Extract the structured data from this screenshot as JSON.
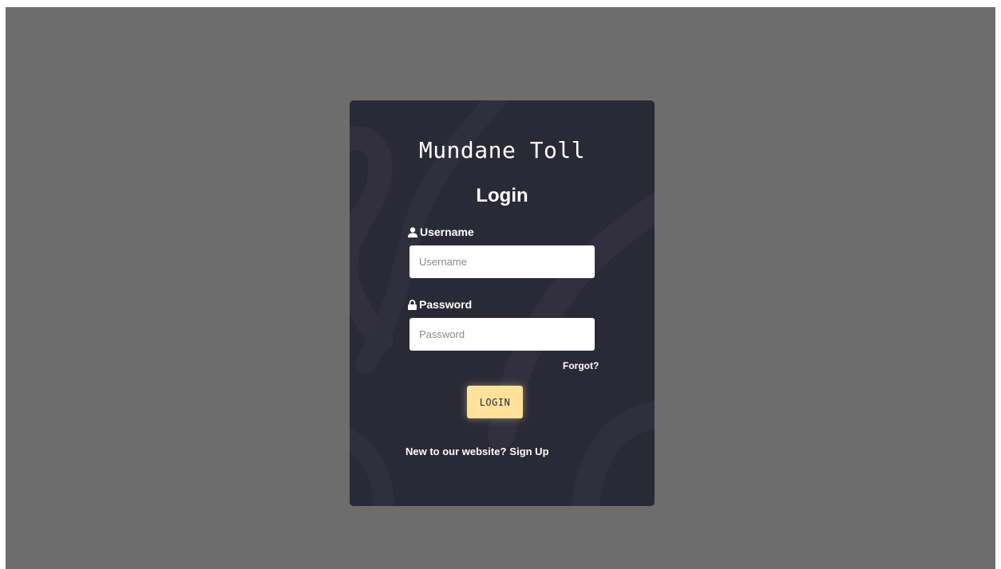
{
  "app": {
    "brand": "Mundane Toll",
    "heading": "Login"
  },
  "form": {
    "username": {
      "label": "Username",
      "placeholder": "Username",
      "value": "",
      "icon": "user-icon"
    },
    "password": {
      "label": "Password",
      "placeholder": "Password",
      "value": "",
      "icon": "lock-icon"
    },
    "forgot_label": "Forgot?",
    "submit_label": "LOGIN"
  },
  "footer": {
    "prompt": "New to our website?",
    "signup_label": "Sign Up"
  },
  "colors": {
    "page_bg": "#6d6d6d",
    "card_bg": "#2a2a36",
    "accent": "#ffe19a",
    "text": "#ffffff"
  }
}
